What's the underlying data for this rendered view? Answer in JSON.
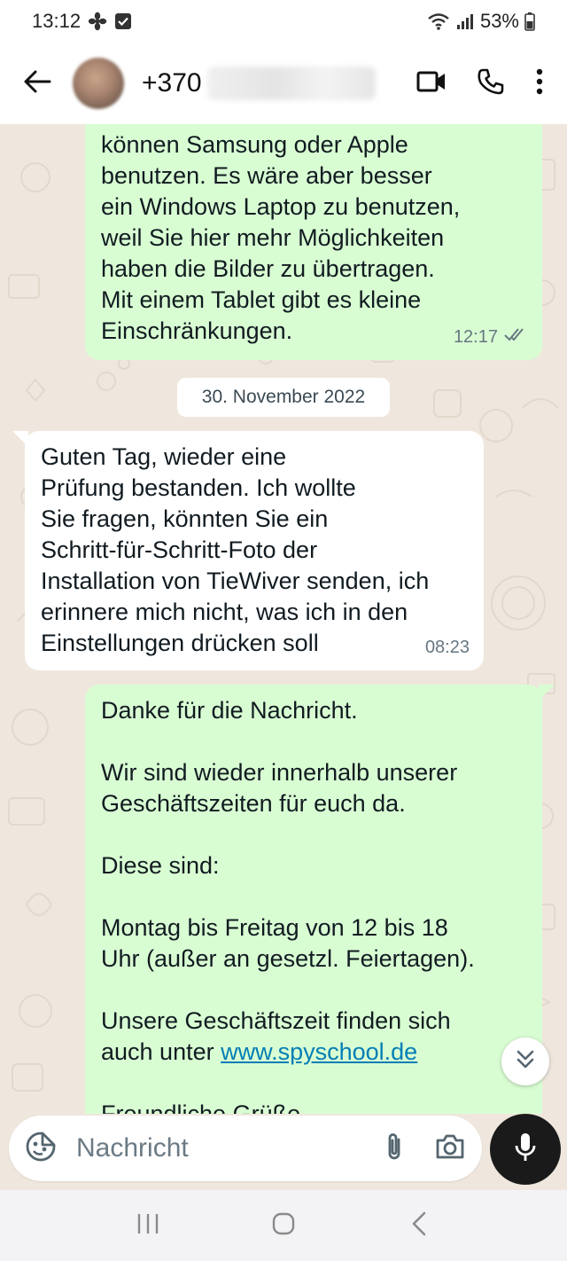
{
  "status_bar": {
    "time": "13:12",
    "battery": "53%"
  },
  "header": {
    "contact_name": "+370"
  },
  "messages": [
    {
      "direction": "out",
      "text": "können Samsung oder Apple\nbenutzen. Es wäre aber besser\nein Windows Laptop zu benutzen,\nweil Sie hier mehr Möglichkeiten\nhaben die Bilder zu übertragen.\nMit einem Tablet gibt es kleine\nEinschränkungen.",
      "time": "12:17",
      "status": "read"
    },
    {
      "date_separator": "30. November 2022"
    },
    {
      "direction": "in",
      "text": "Guten Tag, wieder eine\nPrüfung bestanden.  Ich wollte\nSie fragen, könnten Sie ein\nSchritt-für-Schritt-Foto der\nInstallation von TieWiver senden, ich\nerinnere mich nicht, was ich in den\nEinstellungen drücken soll",
      "time": "08:23"
    },
    {
      "direction": "out",
      "text_p1": "Danke für die Nachricht.\n\nWir sind wieder innerhalb unserer\nGeschäftszeiten für euch da.\n\nDiese sind:\n\nMontag bis Freitag von 12 bis 18\nUhr (außer an gesetzl. Feiertagen).\n\nUnsere Geschäftszeit finden sich\nauch unter ",
      "link": "www.spyschool.de",
      "text_p2_partial": "Freundliche Grüße"
    }
  ],
  "composer": {
    "placeholder": "Nachricht"
  },
  "colors": {
    "outgoing_bubble": "#d9fdd3",
    "incoming_bubble": "#ffffff",
    "wallpaper": "#efe7dd",
    "link": "#027eb5",
    "mic_button": "#1a1a1a"
  },
  "icons": [
    "fan-icon",
    "check-box-icon",
    "wifi-icon",
    "signal-icon",
    "battery-icon",
    "back-arrow-icon",
    "video-call-icon",
    "phone-icon",
    "more-vert-icon",
    "double-check-icon",
    "chevron-double-down-icon",
    "emoji-sticker-icon",
    "attach-icon",
    "camera-icon",
    "mic-icon",
    "recents-icon",
    "home-icon",
    "nav-back-icon"
  ]
}
